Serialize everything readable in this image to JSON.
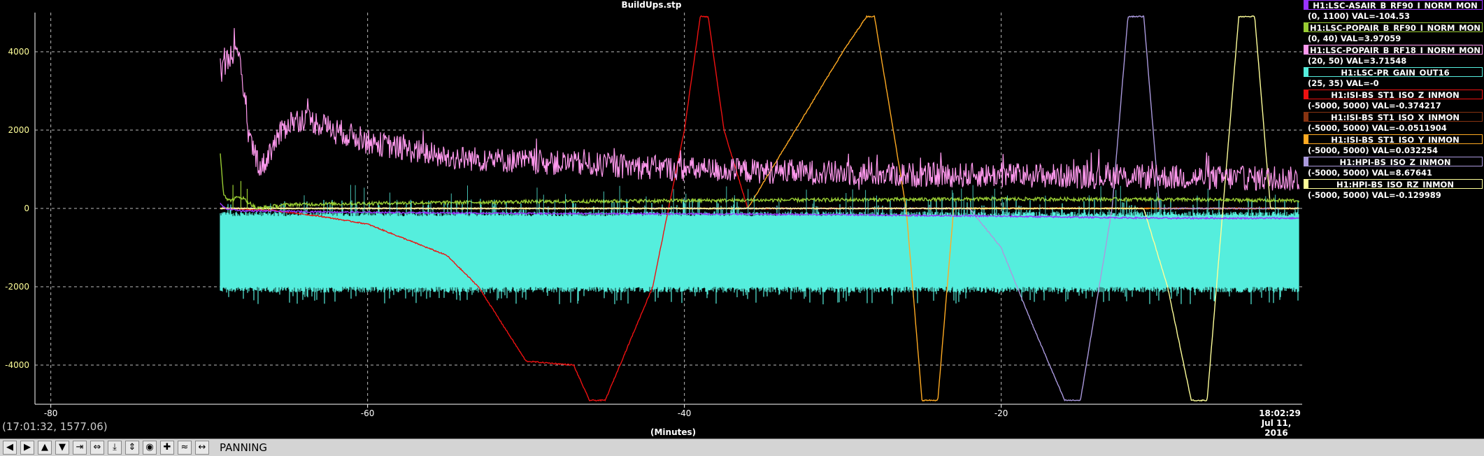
{
  "title": "BuildUps.stp",
  "coord_readout": "(17:01:32, 1577.06)",
  "x_unit": "(Minutes)",
  "time_label": "18:02:29",
  "date_label": "Jul 11, 2016",
  "toolbar": {
    "buttons": [
      {
        "name": "pan-left-button",
        "glyph": "◀"
      },
      {
        "name": "pan-right-button",
        "glyph": "▶"
      },
      {
        "name": "pan-up-button",
        "glyph": "▲"
      },
      {
        "name": "pan-down-button",
        "glyph": "▼"
      },
      {
        "name": "zoom-x-in-button",
        "glyph": "⇥"
      },
      {
        "name": "zoom-x-out-button",
        "glyph": "⇔"
      },
      {
        "name": "zoom-y-in-button",
        "glyph": "⤓"
      },
      {
        "name": "zoom-y-out-button",
        "glyph": "⇕"
      },
      {
        "name": "center-button",
        "glyph": "◉"
      },
      {
        "name": "add-button",
        "glyph": "✚"
      },
      {
        "name": "history-button",
        "glyph": "≈"
      },
      {
        "name": "expand-button",
        "glyph": "↔"
      }
    ],
    "mode": "PANNING"
  },
  "legend": [
    {
      "name": "H1:LSC-ASAIR_B_RF90_I_NORM_MON",
      "range": "(0, 1100) VAL=-104.53",
      "color": "#9933ff"
    },
    {
      "name": "H1:LSC-POPAIR_B_RF90_I_NORM_MON",
      "range": "(0, 40) VAL=3.97059",
      "color": "#99cc33"
    },
    {
      "name": "H1:LSC-POPAIR_B_RF18_I_NORM_MON",
      "range": "(20, 50) VAL=3.71548",
      "color": "#ff99ee"
    },
    {
      "name": "H1:LSC-PR_GAIN_OUT16",
      "range": "(25, 35) VAL=-0",
      "color": "#55eedd"
    },
    {
      "name": "H1:ISI-BS_ST1_ISO_Z_INMON",
      "range": "(-5000, 5000) VAL=-0.374217",
      "color": "#ee1111"
    },
    {
      "name": "H1:ISI-BS_ST1_ISO_X_INMON",
      "range": "(-5000, 5000) VAL=-0.0511904",
      "color": "#883311"
    },
    {
      "name": "H1:ISI-BS_ST1_ISO_Y_INMON",
      "range": "(-5000, 5000) VAL=0.032254",
      "color": "#ffaa22"
    },
    {
      "name": "H1:HPI-BS_ISO_Z_INMON",
      "range": "(-5000, 5000) VAL=8.67641",
      "color": "#aa99dd"
    },
    {
      "name": "H1:HPI-BS_ISO_RZ_INMON",
      "range": "(-5000, 5000) VAL=-0.129989",
      "color": "#ffff99"
    }
  ],
  "chart_data": {
    "type": "line",
    "title": "BuildUps.stp",
    "xlabel": "(Minutes)",
    "ylabel": "",
    "xlim": [
      -81,
      -1
    ],
    "ylim": [
      -5000,
      5000
    ],
    "x_ticks": [
      -80,
      -60,
      -40,
      -20
    ],
    "y_ticks": [
      4000,
      2000,
      0,
      -2000,
      -4000
    ],
    "x_tick_labels": [
      "-80",
      "-60",
      "-40",
      "-20"
    ],
    "y_tick_labels": [
      "4000",
      "2000",
      "0",
      "-2000",
      "-4000"
    ],
    "grid": true,
    "legend_placement": "right",
    "series": [
      {
        "name": "H1:LSC-ASAIR_B_RF90_I_NORM_MON",
        "color": "#9933ff",
        "noise": 20,
        "x": [
          -69.3,
          -69,
          -68,
          -60,
          -50,
          -40,
          -30,
          -20,
          -10,
          -1.2
        ],
        "y": [
          120,
          0,
          -60,
          -100,
          -130,
          -140,
          -160,
          -200,
          -250,
          -250
        ]
      },
      {
        "name": "H1:LSC-POPAIR_B_RF90_I_NORM_MON",
        "color": "#99cc33",
        "noise": 45,
        "x": [
          -69.3,
          -69.1,
          -68.8,
          -68,
          -67,
          -66,
          -65,
          -60,
          -50,
          -40,
          -30,
          -20,
          -10,
          -1.2
        ],
        "y": [
          1400,
          400,
          200,
          300,
          0,
          50,
          100,
          130,
          170,
          200,
          220,
          240,
          230,
          200
        ],
        "spikes": [
          [
            -68.5,
            600
          ],
          [
            -68,
            700
          ],
          [
            -67.6,
            500
          ]
        ]
      },
      {
        "name": "H1:LSC-POPAIR_B_RF18_I_NORM_MON",
        "color": "#ff99ee",
        "noise": 320,
        "x": [
          -69.3,
          -68.5,
          -68,
          -67.5,
          -66.7,
          -66,
          -65,
          -64,
          -62,
          -60,
          -55,
          -50,
          -45,
          -40,
          -35,
          -30,
          -25,
          -20,
          -10,
          -1.2
        ],
        "y": [
          3500,
          4000,
          3600,
          1800,
          1000,
          1600,
          2200,
          2300,
          2000,
          1700,
          1300,
          1200,
          1100,
          1000,
          950,
          900,
          850,
          850,
          800,
          750
        ]
      },
      {
        "name": "H1:LSC-PR_GAIN_OUT16",
        "color": "#55eedd",
        "noise": 0,
        "band": [
          -2000,
          -200
        ],
        "x": [
          -69.3,
          -1.2
        ],
        "y": [
          -1100,
          -1100
        ]
      },
      {
        "name": "H1:ISI-BS_ST1_ISO_Z_INMON",
        "color": "#ee1111",
        "noise": 15,
        "x": [
          -69.3,
          -66,
          -63,
          -60,
          -55,
          -53,
          -50,
          -47,
          -46,
          -45,
          -42,
          -40,
          -39,
          -38.5,
          -37.5,
          -36,
          -33,
          -30,
          -20,
          -10,
          -1.2
        ],
        "y": [
          0,
          -50,
          -200,
          -400,
          -1200,
          -2000,
          -3900,
          -4000,
          -4900,
          -4900,
          -2000,
          2000,
          4900,
          4900,
          2000,
          0,
          0,
          0,
          0,
          0,
          0
        ]
      },
      {
        "name": "H1:ISI-BS_ST1_ISO_X_INMON",
        "color": "#883311",
        "noise": 10,
        "x": [
          -69.3,
          -1.2
        ],
        "y": [
          0,
          0
        ]
      },
      {
        "name": "H1:ISI-BS_ST1_ISO_Y_INMON",
        "color": "#ffaa22",
        "noise": 15,
        "x": [
          -69.3,
          -38,
          -36,
          -33,
          -30,
          -28.5,
          -28,
          -26,
          -25,
          -24,
          -23,
          -20,
          -10,
          -1.2
        ],
        "y": [
          0,
          0,
          0,
          2000,
          4000,
          4900,
          4900,
          0,
          -4900,
          -4900,
          0,
          0,
          0,
          0
        ]
      },
      {
        "name": "H1:HPI-BS_ISO_Z_INMON",
        "color": "#aa99dd",
        "noise": 15,
        "x": [
          -69.3,
          -22,
          -20,
          -18,
          -16,
          -15,
          -13,
          -12,
          -11,
          -10,
          -8,
          -5,
          -1.2
        ],
        "y": [
          0,
          0,
          -1000,
          -3000,
          -4900,
          -4900,
          0,
          4900,
          4900,
          0,
          0,
          0,
          0
        ]
      },
      {
        "name": "H1:HPI-BS_ISO_RZ_INMON",
        "color": "#ffff99",
        "noise": 15,
        "x": [
          -69.3,
          -11,
          -9.5,
          -8,
          -7,
          -6,
          -5,
          -4,
          -3,
          -1.2
        ],
        "y": [
          0,
          0,
          -2000,
          -4900,
          -4900,
          0,
          4900,
          4900,
          0,
          0
        ]
      }
    ]
  }
}
